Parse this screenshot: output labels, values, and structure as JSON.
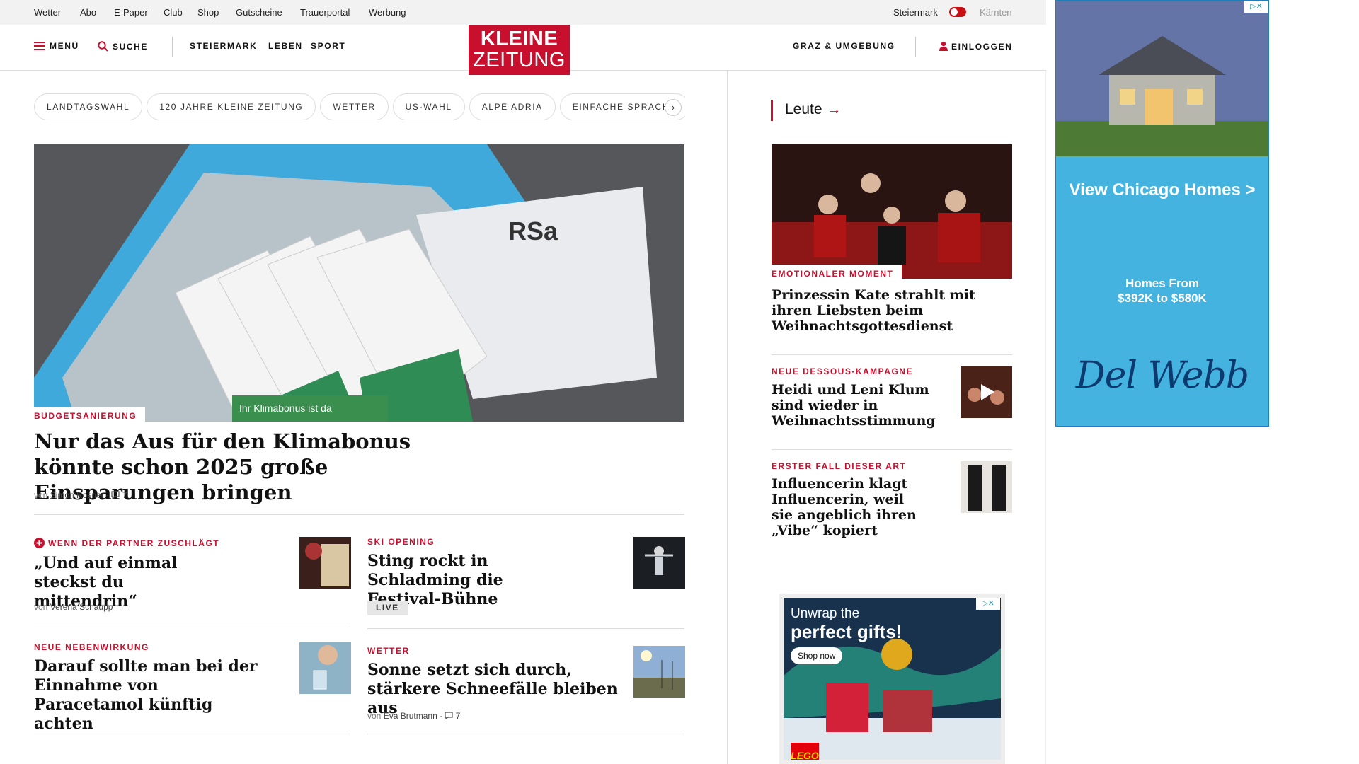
{
  "topbar": {
    "links": [
      "Wetter",
      "Abo",
      "E-Paper",
      "Club",
      "Shop",
      "Gutscheine",
      "Trauerportal",
      "Werbung"
    ],
    "region_active": "Steiermark",
    "region_other": "Kärnten"
  },
  "nav": {
    "menu": "MENÜ",
    "search": "SUCHE",
    "sections": [
      "STEIERMARK",
      "LEBEN",
      "SPORT"
    ],
    "logo_line1": "KLEINE",
    "logo_line2": "ZEITUNG",
    "region": "GRAZ & UMGEBUNG",
    "login": "EINLOGGEN"
  },
  "chips": [
    "LANDTAGSWAHL",
    "120 JAHRE KLEINE ZEITUNG",
    "WETTER",
    "US-WAHL",
    "ALPE ADRIA",
    "EINFACHE SPRACHE"
  ],
  "hero": {
    "kicker": "BUDGETSANIERUNG",
    "title": "Nur das Aus für den Klimabonus könnte schon 2025 große Einsparungen bringen",
    "byline_prefix": "von",
    "author": "Simon Rosner",
    "comments": "7"
  },
  "cards": [
    {
      "kicker": "WENN DER PARTNER ZUSCHLÄGT",
      "title": "„Und auf einmal steckst du mittendrin“",
      "byline_prefix": "von",
      "author": "Verena Schaupp"
    },
    {
      "kicker": "SKI OPENING",
      "title": "Sting rockt in Schladming die Festival-Bühne",
      "badge": "LIVE"
    },
    {
      "kicker": "NEUE NEBENWIRKUNG",
      "title": "Darauf sollte man bei der Einnahme von Paracetamol künftig achten"
    },
    {
      "kicker": "WETTER",
      "title": "Sonne setzt sich durch, stärkere Schneefälle bleiben aus",
      "byline_prefix": "von",
      "author": "Eva Brutmann",
      "comments": "7"
    }
  ],
  "sidebar": {
    "section": "Leute",
    "items": [
      {
        "kicker": "EMOTIONALER MOMENT",
        "title": "Prinzessin Kate strahlt mit ihren Liebsten beim Weihnachtsgottesdienst"
      },
      {
        "kicker": "NEUE DESSOUS-KAMPAGNE",
        "title": "Heidi und Leni Klum sind wieder in Weihnachtsstimmung"
      },
      {
        "kicker": "ERSTER FALL DIESER ART",
        "title": "Influencerin klagt Influencerin, weil sie angeblich ihren „Vibe“ kopiert"
      }
    ]
  },
  "ads": {
    "ad1": {
      "cta": "View Chicago Homes >",
      "price_line1": "Homes From",
      "price_line2": "$392K to $580K",
      "brand": "Del Webb"
    },
    "ad2": {
      "line1": "Unwrap the",
      "line2": "perfect gifts!",
      "button": "Shop now",
      "brand": "LEGO"
    }
  },
  "colors": {
    "brand_red": "#c8102e",
    "ad_blue": "#44b3e0"
  }
}
